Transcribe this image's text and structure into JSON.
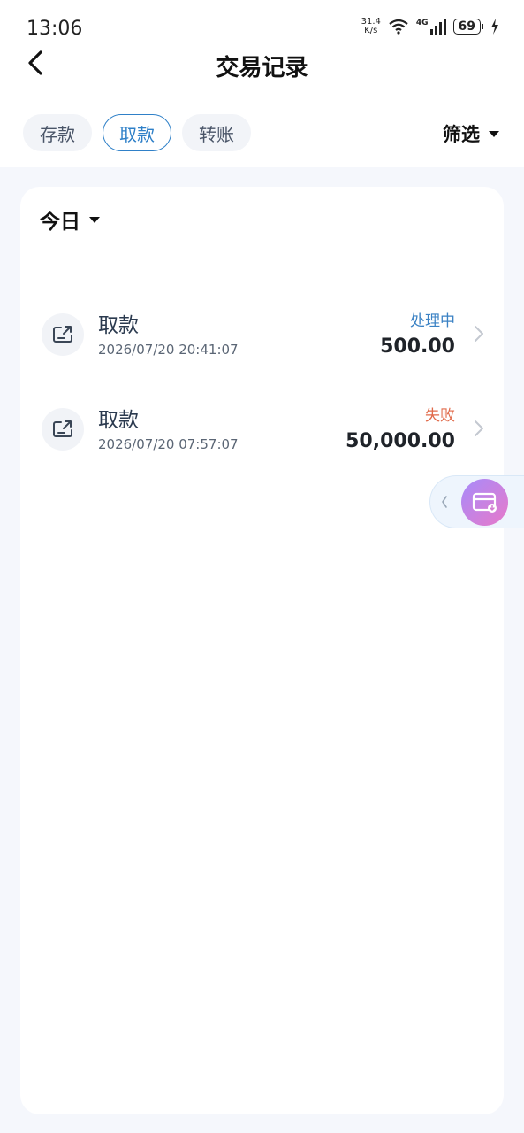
{
  "status_bar": {
    "time": "13:06",
    "net_speed_value": "31.4",
    "net_speed_unit": "K/s",
    "network": "4G",
    "battery": "69"
  },
  "header": {
    "title": "交易记录"
  },
  "tabs": [
    {
      "label": "存款",
      "active": false
    },
    {
      "label": "取款",
      "active": true
    },
    {
      "label": "转账",
      "active": false
    }
  ],
  "filter": {
    "label": "筛选"
  },
  "period": {
    "label": "今日"
  },
  "transactions": [
    {
      "type": "取款",
      "datetime": "2026/07/20 20:41:07",
      "status": "处理中",
      "status_color": "#3b82c4",
      "amount": "500.00"
    },
    {
      "type": "取款",
      "datetime": "2026/07/20 07:57:07",
      "status": "失败",
      "status_color": "#e06a4a",
      "amount": "50,000.00"
    }
  ],
  "colors": {
    "accent": "#2f80c8",
    "background": "#f5f7fc"
  }
}
